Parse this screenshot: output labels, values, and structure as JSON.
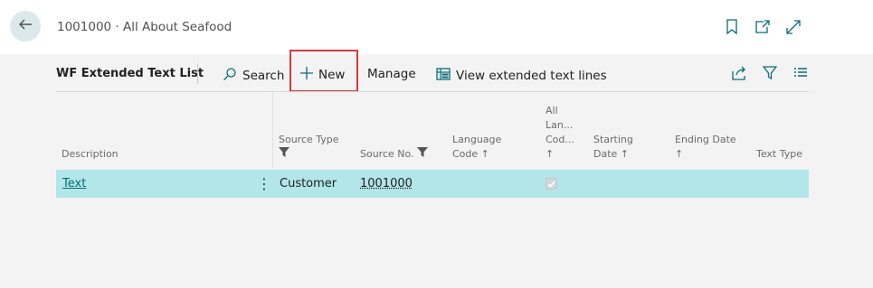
{
  "header": {
    "page_title": "1001000 · All About Seafood"
  },
  "actions": {
    "list_title": "WF Extended Text List",
    "search_label": "Search",
    "new_label": "New",
    "manage_label": "Manage",
    "view_lines_label": "View extended text lines"
  },
  "columns": {
    "description": "Description",
    "source_type": "Source Type",
    "source_no": "Source No.",
    "language_code_1": "Language",
    "language_code_2": "Code ↑",
    "all_lan_1": "All",
    "all_lan_2": "Lan...",
    "all_lan_3": "Cod...",
    "all_lan_4": "↑",
    "starting_1": "Starting",
    "starting_2": "Date ↑",
    "ending_1": "Ending Date",
    "ending_2": "↑",
    "text_type": "Text Type"
  },
  "row": {
    "description": "Text",
    "source_type": "Customer",
    "source_no": "1001000",
    "all_languages": true
  },
  "colors": {
    "accent": "#0a6b7a",
    "selected_row": "#b2e6e8",
    "highlight": "#d9393b"
  }
}
